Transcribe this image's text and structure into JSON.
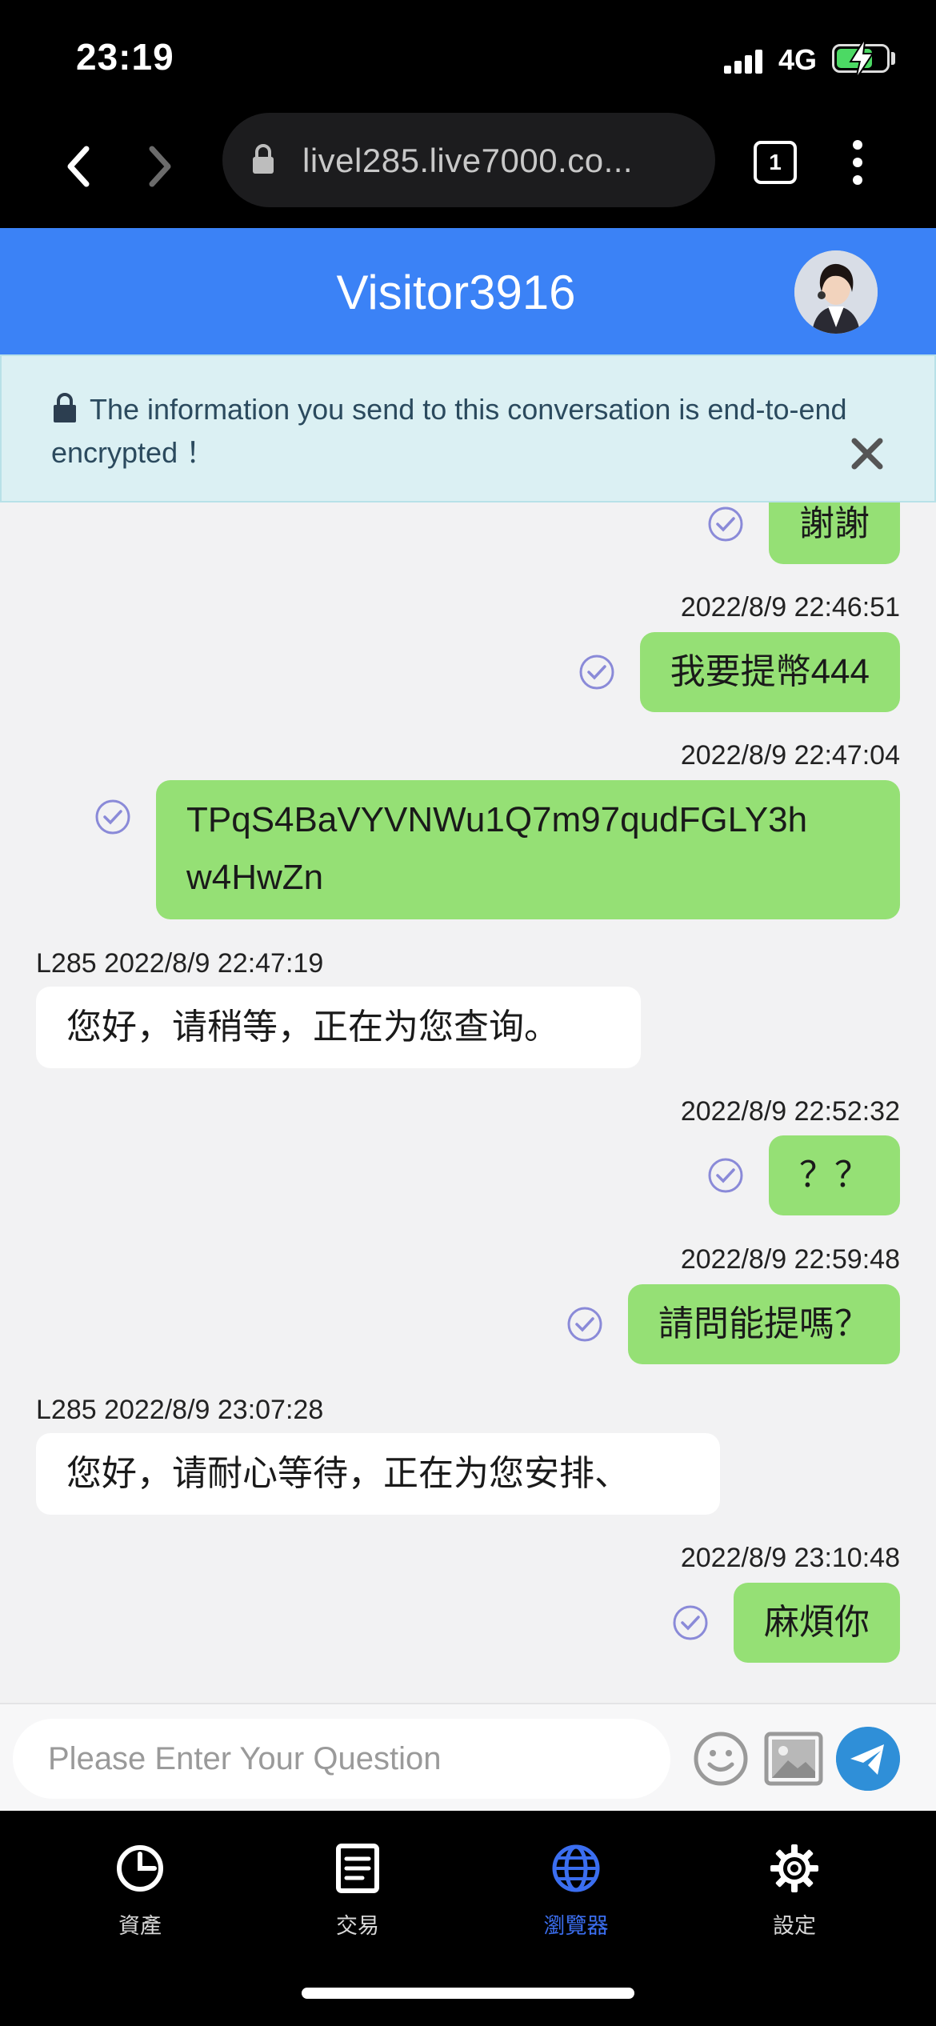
{
  "status_bar": {
    "time": "23:19",
    "network": "4G"
  },
  "browser": {
    "url": "livel285.live7000.co...",
    "tab_count": "1"
  },
  "chat": {
    "title": "Visitor3916",
    "notice": "The information you send to this conversation is end-to-end encrypted ！",
    "messages": [
      {
        "dir": "out",
        "time": "",
        "text": "謝謝"
      },
      {
        "dir": "out",
        "time": "2022/8/9 22:46:51",
        "text": "我要提幣444"
      },
      {
        "dir": "out",
        "time": "2022/8/9 22:47:04",
        "text": "TPqS4BaVYVNWu1Q7m97qudFGLY3hw4HwZn",
        "line1": "TPqS4BaVYVNWu1Q7m97qudFGLY3h",
        "line2": "w4HwZn"
      },
      {
        "dir": "in",
        "sender": "L285",
        "time": "L285 2022/8/9 22:47:19",
        "text": "您好，请稍等，正在为您查询。"
      },
      {
        "dir": "out",
        "time": "2022/8/9 22:52:32",
        "text": "？？"
      },
      {
        "dir": "out",
        "time": "2022/8/9 22:59:48",
        "text": "請問能提嗎？"
      },
      {
        "dir": "in",
        "sender": "L285",
        "time": "L285 2022/8/9 23:07:28",
        "text": "您好，请耐心等待，正在为您安排、"
      },
      {
        "dir": "out",
        "time": "2022/8/9 23:10:48",
        "text": "麻煩你"
      }
    ]
  },
  "input": {
    "placeholder": "Please Enter Your Question"
  },
  "tabs": [
    {
      "label": "資產",
      "icon": "pie-chart-icon",
      "active": false
    },
    {
      "label": "交易",
      "icon": "document-icon",
      "active": false
    },
    {
      "label": "瀏覽器",
      "icon": "globe-icon",
      "active": true
    },
    {
      "label": "設定",
      "icon": "gear-icon",
      "active": false
    }
  ],
  "colors": {
    "header_blue": "#3b82f6",
    "outgoing_bubble": "#95e075",
    "active_tab": "#3b6ef0",
    "send_button": "#2f8fd8"
  }
}
